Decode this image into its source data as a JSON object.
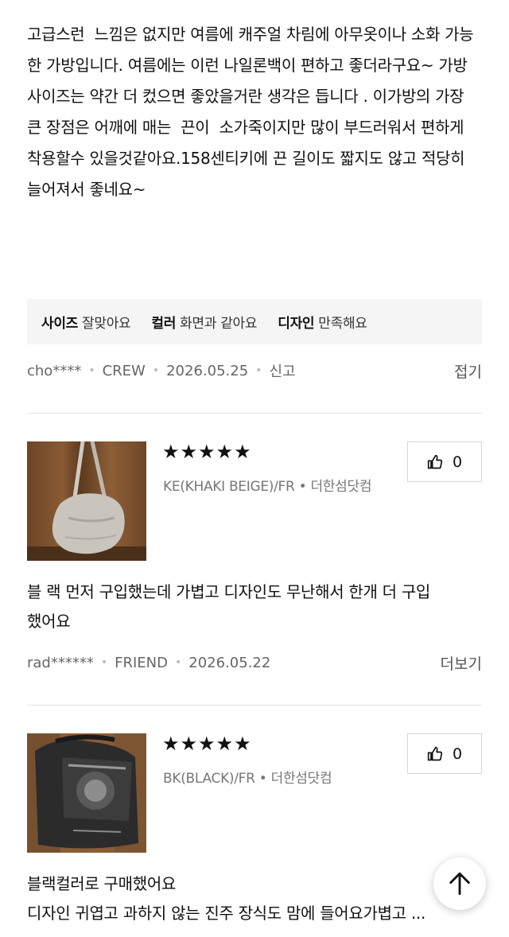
{
  "review1": {
    "text": "고급스런  느낌은 없지만 여름에 캐주얼 차림에 아무옷이나 소화 가능한 가방입니다. 여름에는 이런 나일론백이 편하고 좋더라구요~ 가방  사이즈는 약간 더 컸으면 좋았을거란 생각은 듭니다 . 이가방의 가장 큰 장점은 어깨에 매는  끈이  소가죽이지만 많이 부드러워서 편하게 착용할수 있을것같아요.158센티키에 끈 길이도 짧지도 않고 적당히 늘어져서 좋네요~",
    "attributes": [
      {
        "key": "사이즈",
        "value": "잘맞아요"
      },
      {
        "key": "컬러",
        "value": "화면과 같아요"
      },
      {
        "key": "디자인",
        "value": "만족해요"
      }
    ],
    "user": "cho****",
    "membership": "CREW",
    "date": "2026.05.25",
    "report": "신고",
    "toggle": "접기"
  },
  "review2": {
    "stars": "★★★★★",
    "option": "KE(KHAKI BEIGE)/FR • 더한섬닷컴",
    "likes": "0",
    "text_line1": "블 랙 먼저 구입했는데 가볍고 디자인도 무난해서 한개 더 구입",
    "text_line2": "했어요",
    "user": "rad******",
    "membership": "FRIEND",
    "date": "2026.05.22",
    "toggle": "더보기"
  },
  "review3": {
    "stars": "★★★★★",
    "option": "BK(BLACK)/FR • 더한섬닷컴",
    "likes": "0",
    "text_line1": "블랙컬러로 구매했어요",
    "text_line2": "디자인 귀엽고 과하지 않는 진주 장식도 맘에 들어요가볍고 ..."
  },
  "icons": {
    "like": "thumbs-up-icon",
    "scroll_top": "arrow-up-icon"
  }
}
